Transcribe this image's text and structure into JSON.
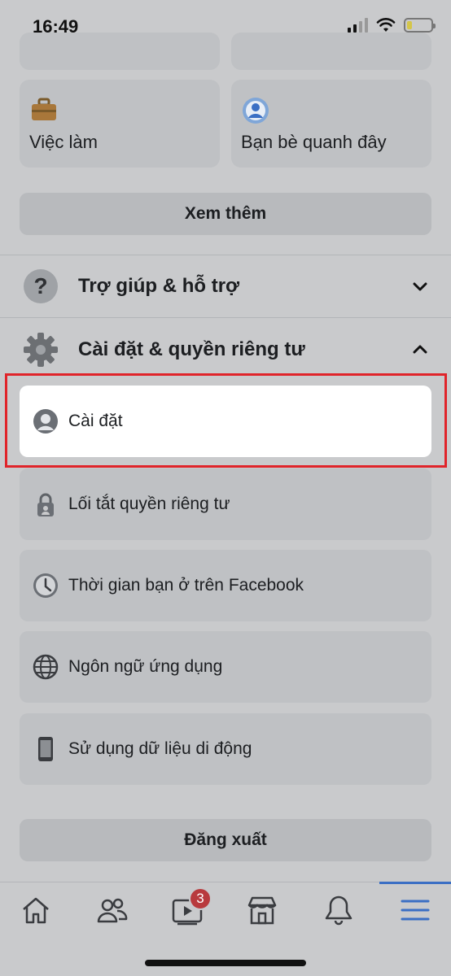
{
  "status_bar": {
    "time": "16:49"
  },
  "shortcuts": [
    {
      "label": "Việc làm",
      "icon": "briefcase-icon"
    },
    {
      "label": "Bạn bè quanh đây",
      "icon": "nearby-friends-icon"
    }
  ],
  "see_more_label": "Xem thêm",
  "sections": {
    "help": {
      "label": "Trợ giúp & hỗ trợ",
      "icon": "question-icon",
      "expanded": false
    },
    "settings_privacy": {
      "label": "Cài đặt & quyền riêng tư",
      "icon": "gear-icon",
      "expanded": true
    }
  },
  "settings_menu": [
    {
      "label": "Cài đặt",
      "icon": "profile-settings-icon",
      "highlighted": true
    },
    {
      "label": "Lối tắt quyền riêng tư",
      "icon": "lock-icon"
    },
    {
      "label": "Thời gian bạn ở trên Facebook",
      "icon": "clock-icon"
    },
    {
      "label": "Ngôn ngữ ứng dụng",
      "icon": "globe-icon"
    },
    {
      "label": "Sử dụng dữ liệu di động",
      "icon": "phone-icon"
    }
  ],
  "logout_label": "Đăng xuất",
  "tabbar": {
    "tabs": [
      "home-icon",
      "friends-icon",
      "watch-icon",
      "marketplace-icon",
      "bell-icon",
      "menu-icon"
    ],
    "watch_badge": "3",
    "active_tab": "menu-icon"
  },
  "colors": {
    "highlight": "#e0242a",
    "active_tab": "#3b6fc4",
    "badge": "#b83a3d"
  }
}
